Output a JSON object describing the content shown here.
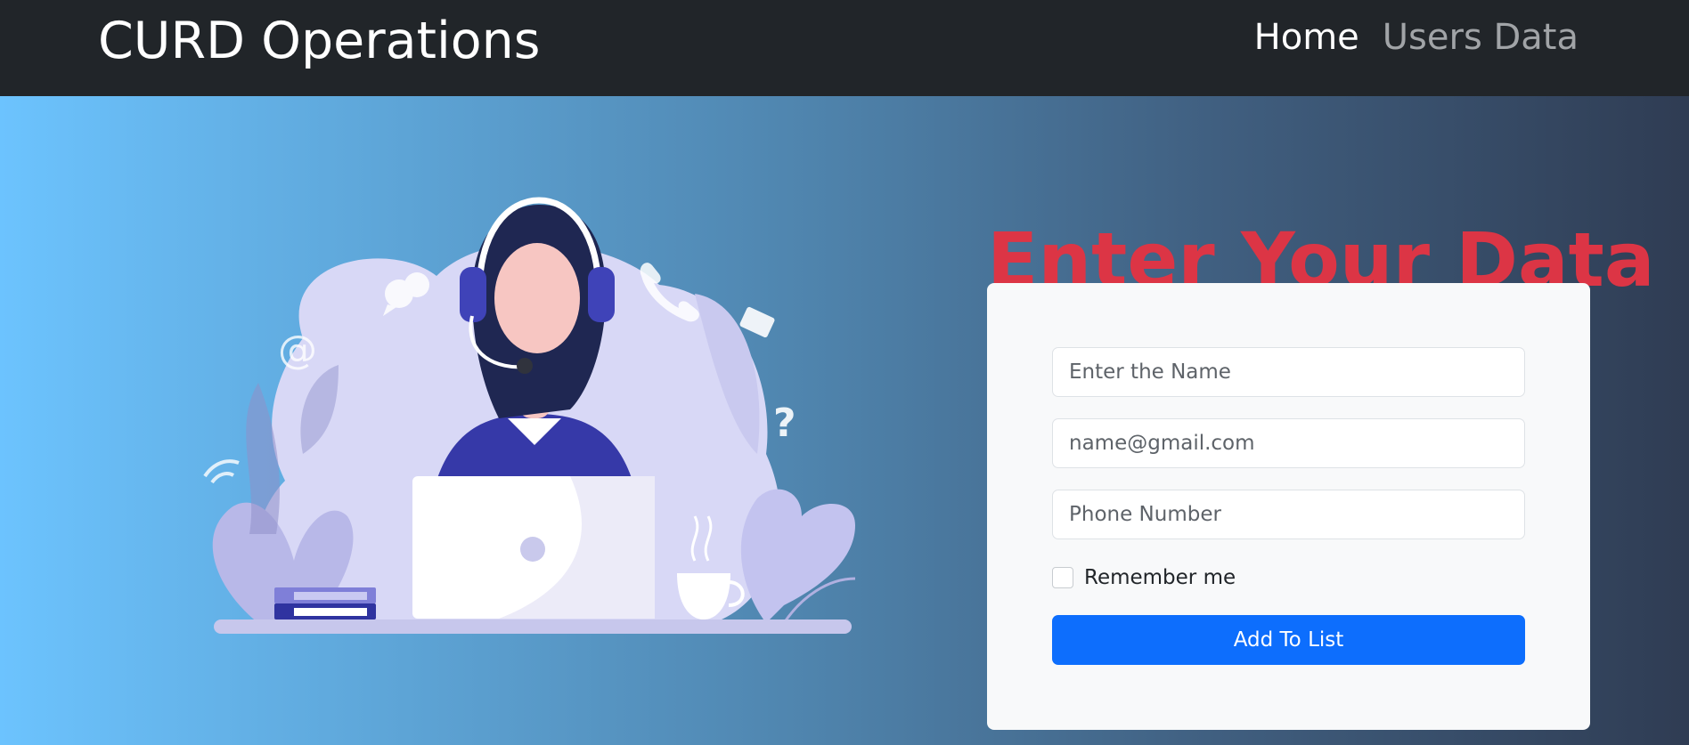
{
  "navbar": {
    "brand": "CURD Operations",
    "links": [
      {
        "label": "Home",
        "active": true
      },
      {
        "label": "Users Data",
        "active": false
      }
    ]
  },
  "form": {
    "title": "Enter Your Data",
    "name_placeholder": "Enter the Name",
    "email_placeholder": "name@gmail.com",
    "phone_placeholder": "Phone Number",
    "remember_label": "Remember me",
    "remember_checked": false,
    "submit_label": "Add To List"
  },
  "illustration": {
    "icons": [
      "speech-bubble-icon",
      "at-sign-icon",
      "phone-icon",
      "envelope-icon",
      "question-mark-icon",
      "wifi-icon",
      "coffee-cup-icon",
      "books-icon",
      "laptop-icon",
      "headset-icon"
    ]
  },
  "colors": {
    "navbar_bg": "#212529",
    "title": "#dc3545",
    "button": "#0d6efd",
    "card_bg": "#f8f9fa",
    "hero_gradient_start": "#6cc3fe",
    "hero_gradient_end": "#2f3c53"
  }
}
